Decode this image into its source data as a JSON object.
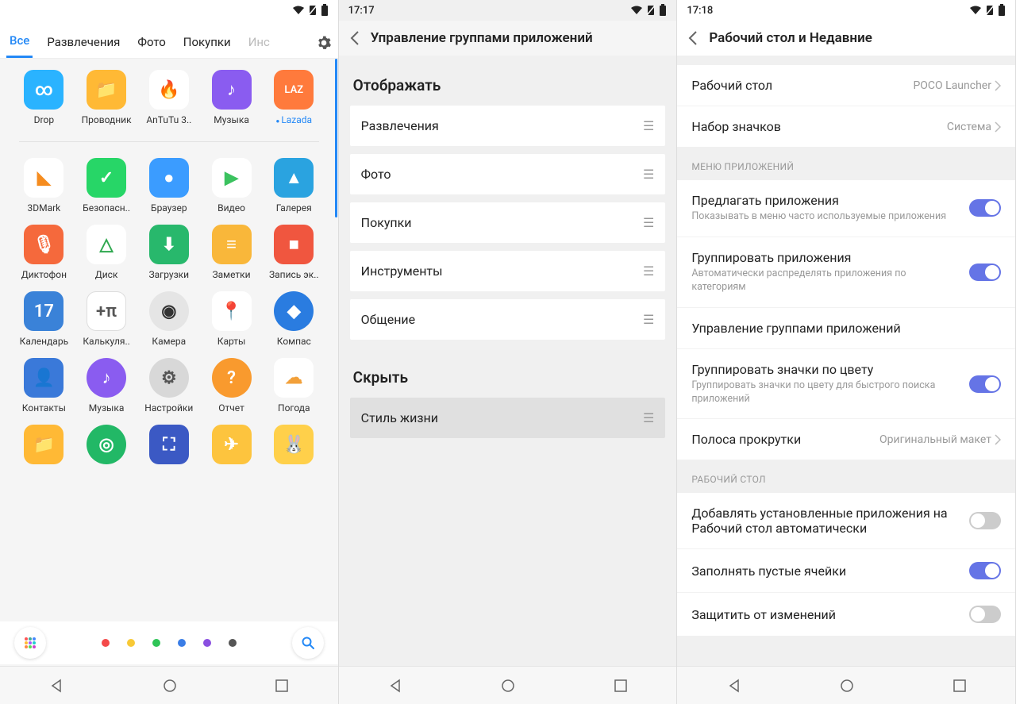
{
  "pane1": {
    "tabs": [
      "Все",
      "Развлечения",
      "Фото",
      "Покупки",
      "Инс"
    ],
    "active_tab": 0,
    "apps": [
      [
        {
          "name": "Drop",
          "color": "#2ab3ff",
          "glyph": "∞"
        },
        {
          "name": "Проводник",
          "color": "#ffb935",
          "glyph": "📁"
        },
        {
          "name": "AnTuTu 3..",
          "color": "#fff",
          "glyph": "🔥",
          "txt": "#d22"
        },
        {
          "name": "Музыка",
          "color": "#8a5cf0",
          "glyph": "♪"
        },
        {
          "name": "Lazada",
          "color": "#ff7a3c",
          "glyph": "LAZ",
          "new": true
        }
      ],
      [
        {
          "name": "3DMark",
          "color": "#fff",
          "glyph": "◣",
          "txt": "#f58c1f"
        },
        {
          "name": "Безопасн..",
          "color": "#27d667",
          "glyph": "✓"
        },
        {
          "name": "Браузер",
          "color": "#3b9cff",
          "glyph": "●"
        },
        {
          "name": "Видео",
          "color": "#fff",
          "glyph": "▶",
          "txt": "#3bc25f"
        },
        {
          "name": "Галерея",
          "color": "#2aa3e0",
          "glyph": "▲"
        }
      ],
      [
        {
          "name": "Диктофон",
          "color": "#f5693c",
          "glyph": "🎙"
        },
        {
          "name": "Диск",
          "color": "#fff",
          "glyph": "△",
          "txt": "#2fa84f"
        },
        {
          "name": "Загрузки",
          "color": "#28b86c",
          "glyph": "⬇"
        },
        {
          "name": "Заметки",
          "color": "#f9b73a",
          "glyph": "≡"
        },
        {
          "name": "Запись эк..",
          "color": "#f0563f",
          "glyph": "■"
        }
      ],
      [
        {
          "name": "Календарь",
          "color": "#3a82d8",
          "glyph": "17"
        },
        {
          "name": "Калькуля..",
          "color": "#fff",
          "glyph": "+π",
          "txt": "#555",
          "sq": true
        },
        {
          "name": "Камера",
          "color": "#e5e5e5",
          "glyph": "◉",
          "txt": "#333",
          "round": true
        },
        {
          "name": "Карты",
          "color": "#fff",
          "glyph": "📍",
          "txt": "#d33"
        },
        {
          "name": "Компас",
          "color": "#2a7ce0",
          "glyph": "◆",
          "round": true
        }
      ],
      [
        {
          "name": "Контакты",
          "color": "#3a79d9",
          "glyph": "👤"
        },
        {
          "name": "Музыка",
          "color": "#8a5cf0",
          "glyph": "♪",
          "round": true
        },
        {
          "name": "Настройки",
          "color": "#d8d8d8",
          "glyph": "⚙",
          "txt": "#555",
          "round": true
        },
        {
          "name": "Отчет",
          "color": "#f99a2e",
          "glyph": "?",
          "round": true
        },
        {
          "name": "Погода",
          "color": "#fff",
          "glyph": "☁",
          "txt": "#f2a03a"
        }
      ],
      [
        {
          "name": "",
          "color": "#ffb935",
          "glyph": "📁"
        },
        {
          "name": "",
          "color": "#22b866",
          "glyph": "◎",
          "round": true
        },
        {
          "name": "",
          "color": "#3b59c4",
          "glyph": "⛶"
        },
        {
          "name": "",
          "color": "#fdc43e",
          "glyph": "✈"
        },
        {
          "name": "",
          "color": "#ffd04a",
          "glyph": "🐰"
        }
      ]
    ],
    "dock_colors": [
      "#f44a4a",
      "#f8c936",
      "#2fc457",
      "#3a7de6",
      "#8a4fe0",
      "#555"
    ]
  },
  "pane2": {
    "time": "17:17",
    "title": "Управление группами приложений",
    "section1": "Отображать",
    "show_groups": [
      "Развлечения",
      "Фото",
      "Покупки",
      "Инструменты",
      "Общение"
    ],
    "section2": "Скрыть",
    "hide_groups": [
      "Стиль жизни"
    ]
  },
  "pane3": {
    "time": "17:18",
    "title": "Рабочий стол и Недавние",
    "top": [
      {
        "t": "Рабочий стол",
        "v": "POCO Launcher"
      },
      {
        "t": "Набор значков",
        "v": "Система"
      }
    ],
    "cap1": "МЕНЮ ПРИЛОЖЕНИЙ",
    "menu": [
      {
        "t": "Предлагать приложения",
        "d": "Показывать в меню часто используемые приложения",
        "toggle": true
      },
      {
        "t": "Группировать приложения",
        "d": "Автоматически распределять приложения по категориям",
        "toggle": true
      },
      {
        "t": "Управление группами приложений"
      },
      {
        "t": "Группировать значки по цвету",
        "d": "Группировать значки по цвету для быстрого поиска приложений",
        "toggle": true
      },
      {
        "t": "Полоса прокрутки",
        "v": "Оригинальный макет"
      }
    ],
    "cap2": "РАБОЧИЙ СТОЛ",
    "desk": [
      {
        "t": "Добавлять установленные приложения на Рабочий стол автоматически",
        "toggle": false
      },
      {
        "t": "Заполнять пустые ячейки",
        "toggle": true
      },
      {
        "t": "Защитить от изменений",
        "toggle": false
      }
    ]
  }
}
